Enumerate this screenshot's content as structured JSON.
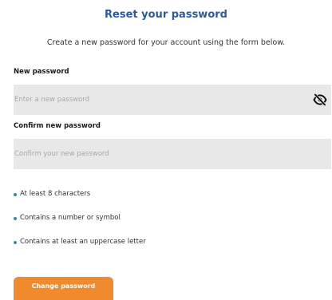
{
  "header": {
    "title": "Reset your password",
    "subtitle": "Create a new password for your account using the form below."
  },
  "form": {
    "new_password": {
      "label": "New password",
      "placeholder": "Enter a new password",
      "value": "",
      "icon": "eye-slash-icon"
    },
    "confirm_password": {
      "label": "Confirm new password",
      "placeholder": "Confirm your new password",
      "value": ""
    },
    "requirements": [
      "At least 8 characters",
      "Contains a number or symbol",
      "Contains at least an uppercase letter"
    ],
    "submit_label": "Change password"
  },
  "colors": {
    "title": "#2b5a9e",
    "input_background": "#e8e8e8",
    "bullet": "#2a8fa8",
    "button": "#f08a2c",
    "button_text": "#ffffff"
  }
}
